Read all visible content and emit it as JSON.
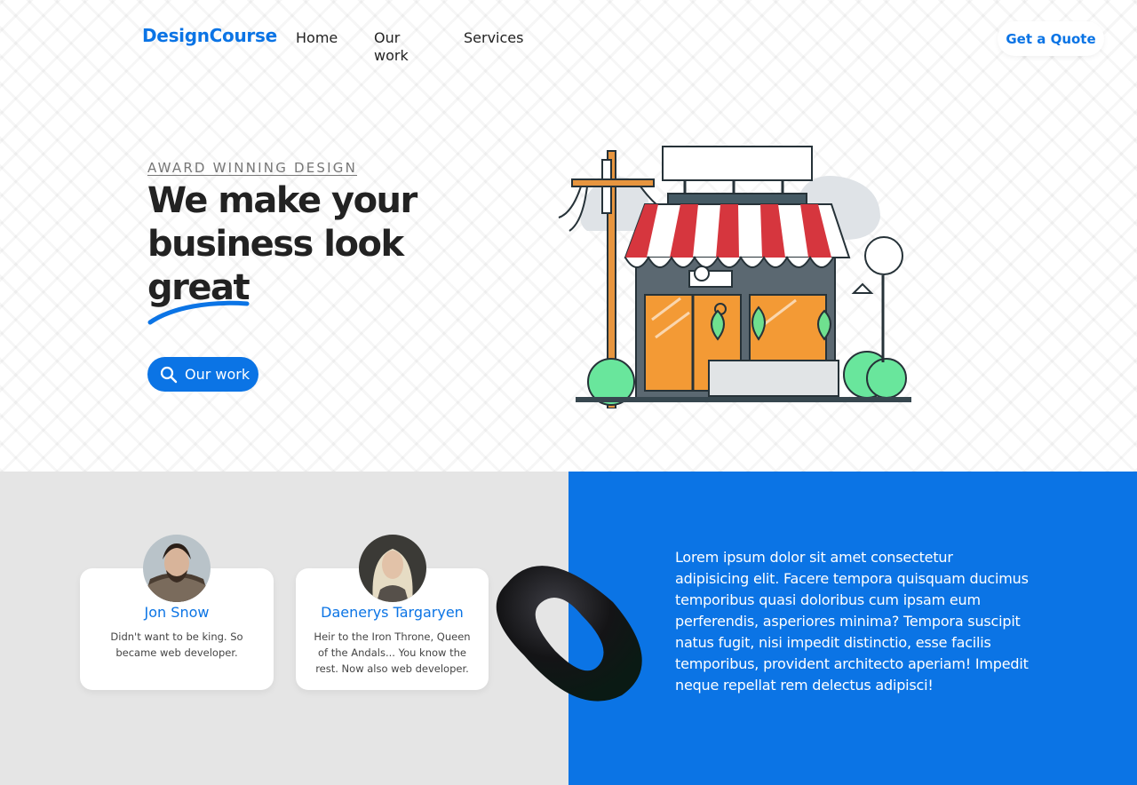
{
  "header": {
    "logo": "DesignCourse",
    "nav": [
      "Home",
      "Our work",
      "Services"
    ],
    "cta_label": "Get a Quote"
  },
  "hero": {
    "eyebrow": "AWARD WINNING DESIGN",
    "headline_line1": "We make your",
    "headline_line2": "business look",
    "headline_emphasis": "great",
    "button_label": "Our work",
    "button_icon": "search-icon",
    "illustration": "storefront-illustration"
  },
  "testimonials": [
    {
      "name": "Jon Snow",
      "description": "Didn't want to be king. So became web developer."
    },
    {
      "name": "Daenerys Targaryen",
      "description": "Heir to the Iron Throne, Queen of the Andals... You know the rest. Now also web developer."
    }
  ],
  "about": {
    "text": "Lorem ipsum dolor sit amet consectetur adipisicing elit. Facere tempora quisquam ducimus temporibus quasi doloribus cum ipsam eum perferendis, asperiores minima? Tempora suscipit natus fugit, nisi impedit distinctio, esse facilis temporibus, provident architecto aperiam! Impedit neque repellat rem delectus adipisci!"
  },
  "colors": {
    "brand": "#0b74e5",
    "hero_background": "#ffffff",
    "lower_left_background": "#e5e5e5",
    "lower_right_background": "#0b74e5",
    "heading": "#222222"
  }
}
